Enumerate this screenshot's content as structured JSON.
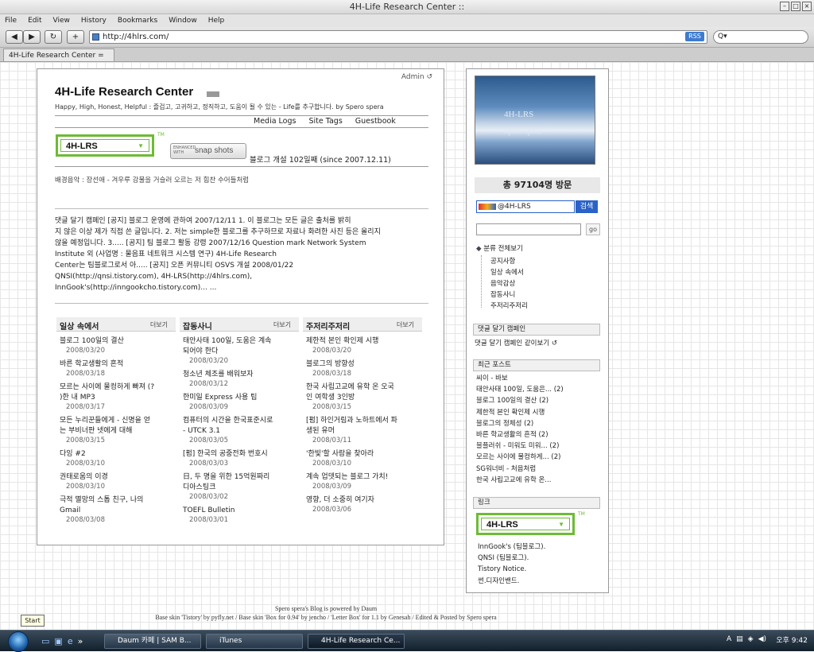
{
  "window": {
    "title": "4H-Life Research Center ::"
  },
  "menu": [
    "File",
    "Edit",
    "View",
    "History",
    "Bookmarks",
    "Window",
    "Help"
  ],
  "toolbar": {
    "url": "http://4hlrs.com/",
    "rss": "RSS",
    "search_placeholder": "Q▾"
  },
  "tab": {
    "label": "4H-Life Research Center ="
  },
  "blog": {
    "admin": "Admin",
    "title": "4H-Life Research Center",
    "subtitle": "Happy, High, Honest, Helpful : 즐겁고, 고귀하고, 정직하고, 도움이 될 수 있는 - Life를 추구합니다. by Spero spera",
    "nav": [
      "Media Logs",
      "Site Tags",
      "Guestbook"
    ],
    "logo_text": "4H-LRS",
    "tm": "TM",
    "snap_small": "ENHANCED WITH",
    "snap_label": "snap shots",
    "open_info": "블로그 개설 102일째 (since 2007.12.11)",
    "bgm": "배경음악 : 장선애 - 겨우루 강물을 거슬러 오르는 저 힘찬 수어들처럼",
    "notice_lines": [
      "댓글 달기 캠페인 [공지] 블로그 운영에 관하여 2007/12/11 1. 이 블로그는 모든 글은 출처를 밝히",
      "지 않은 이상 제가 직접 쓴 글입니다. 2. 저는 simple한 블로그를 추구하므로 자료나 화려한 사진 등은 올리지",
      "않을 예정입니다. 3..... [공지] 팀 블로그 활동 강령 2007/12/16 Question mark Network System",
      "Institute 외 (사업명 : 물음표 네트워크 시스템 연구) 4H-Life Research",
      "Center는 팀블로그로서 아..... [공지] 오픈 커뮤니티 OSVS 개설 2008/01/22",
      "QNSI(http://qnsi.tistory.com), 4H-LRS(http://4hlrs.com),",
      "InnGook's(http://inngookcho.tistory.com)... ..."
    ],
    "columns": [
      {
        "title": "일상 속에서",
        "more": "더보기",
        "posts": [
          {
            "lines": [
              "블로그 100일의 결산"
            ],
            "date": "2008/03/20"
          },
          {
            "lines": [
              "바른 학교생활의 흔적"
            ],
            "date": "2008/03/18"
          },
          {
            "lines": [
              "모르는 사이에 물컹하게 빠져 (?",
              ")한 내 MP3"
            ],
            "date": "2008/03/17"
          },
          {
            "lines": [
              "모든 누리꾼들에게 - 신명을 얻",
              "는 부비너판 넷에게 대해"
            ],
            "date": "2008/03/15"
          },
          {
            "lines": [
              "다잉 #2"
            ],
            "date": "2008/03/10"
          },
          {
            "lines": [
              "권태로움의 이경"
            ],
            "date": "2008/03/10"
          },
          {
            "lines": [
              "극적 멸망의 스톱 친구, 나의",
              "Gmail"
            ],
            "date": "2008/03/08"
          }
        ]
      },
      {
        "title": "잡동사니",
        "more": "더보기",
        "posts": [
          {
            "lines": [
              "태안사태 100일, 도움은 계속",
              "되어야 한다"
            ],
            "date": "2008/03/20"
          },
          {
            "lines": [
              "청소년 체조를 배워보자"
            ],
            "date": "2008/03/12"
          },
          {
            "lines": [
              "한미일 Express 사용 팁"
            ],
            "date": "2008/03/09"
          },
          {
            "lines": [
              "컴퓨터의 시간을 한국표준시로",
              "- UTCK 3.1"
            ],
            "date": "2008/03/05"
          },
          {
            "lines": [
              "[펌] 한국의 공중전화 번호시"
            ],
            "date": "2008/03/03"
          },
          {
            "lines": [
              "日, 두 명을 위한 15억원짜리",
              "디아스팅크"
            ],
            "date": "2008/03/02"
          },
          {
            "lines": [
              "TOEFL Bulletin"
            ],
            "date": "2008/03/01"
          }
        ]
      },
      {
        "title": "주저리주저리",
        "more": "더보기",
        "posts": [
          {
            "lines": [
              "제한적 본인 확인제 시행"
            ],
            "date": "2008/03/20"
          },
          {
            "lines": [
              "블로그의 방향성"
            ],
            "date": "2008/03/18"
          },
          {
            "lines": [
              "한국 사립고교에 유학 온 오국",
              "인 여학생 3인방"
            ],
            "date": "2008/03/15"
          },
          {
            "lines": [
              "[펌] 하인거림과 노하트에서 파",
              "생된 유머"
            ],
            "date": "2008/03/11"
          },
          {
            "lines": [
              "'한빛'할 사람을 찾아라"
            ],
            "date": "2008/03/10"
          },
          {
            "lines": [
              "계속 업뎃되는 블로그 가치!"
            ],
            "date": "2008/03/09"
          },
          {
            "lines": [
              "영향, 더 소중히 여기자"
            ],
            "date": "2008/03/06"
          }
        ]
      }
    ]
  },
  "sidebar": {
    "image_line1": "4H-LRS",
    "image_line2": "Spero spera",
    "visits": "총 97104명 방문",
    "daum_text": "@4H-LRS",
    "daum_btn": "검색",
    "search_btn": "go",
    "category_root": "분류 전체보기",
    "categories": [
      "공지사항",
      "일상 속에서",
      "음악감상",
      "잡동사니",
      "주저리주저리"
    ],
    "campaign_title": "댓글 달기 캠페인",
    "campaign_link": "댓글 달기 캠페인 같이보기",
    "recent_title": "최근 포스트",
    "recent": [
      "씨이 - 바보",
      "태안사태 100일, 도움은... (2)",
      "블로그 100일의 결산 (2)",
      "제한적 본인 확인제 시행",
      "블로그의 정체성 (2)",
      "바른 학교생활의 흔적 (2)",
      "블플러쉬 - 미워도 미워... (2)",
      "모르는 사이에 물컹하게... (2)",
      "SG워너비 - 처음처럼",
      "한국 사립고교에 유학 온..."
    ],
    "links_title": "링크",
    "logo_text": "4H-LRS",
    "tm": "TM",
    "links": [
      "InnGook's (팀블로그).",
      "QNSI (팀블로그).",
      "Tistory Notice.",
      "썬.디자인밴드."
    ]
  },
  "footer": {
    "line1": "Spero spera's Blog is powered by Daum",
    "line2": "Base skin 'Tistory' by pyfly.net / Base skin 'Box for 0.94' by jencho / 'Letter Box' for 1.1 by Genesah / Edited & Posted by Spero spera"
  },
  "taskbar": {
    "start_tip": "Start",
    "buttons": [
      "Daum 카페 | SAM B...",
      "iTunes",
      "4H-Life Research Ce..."
    ],
    "lang": "A",
    "clock": "오후 9:42"
  },
  "colors": {
    "accent_green": "#6dbb36",
    "taskbar": "#1b2a38",
    "daum_blue": "#2a62c6"
  }
}
